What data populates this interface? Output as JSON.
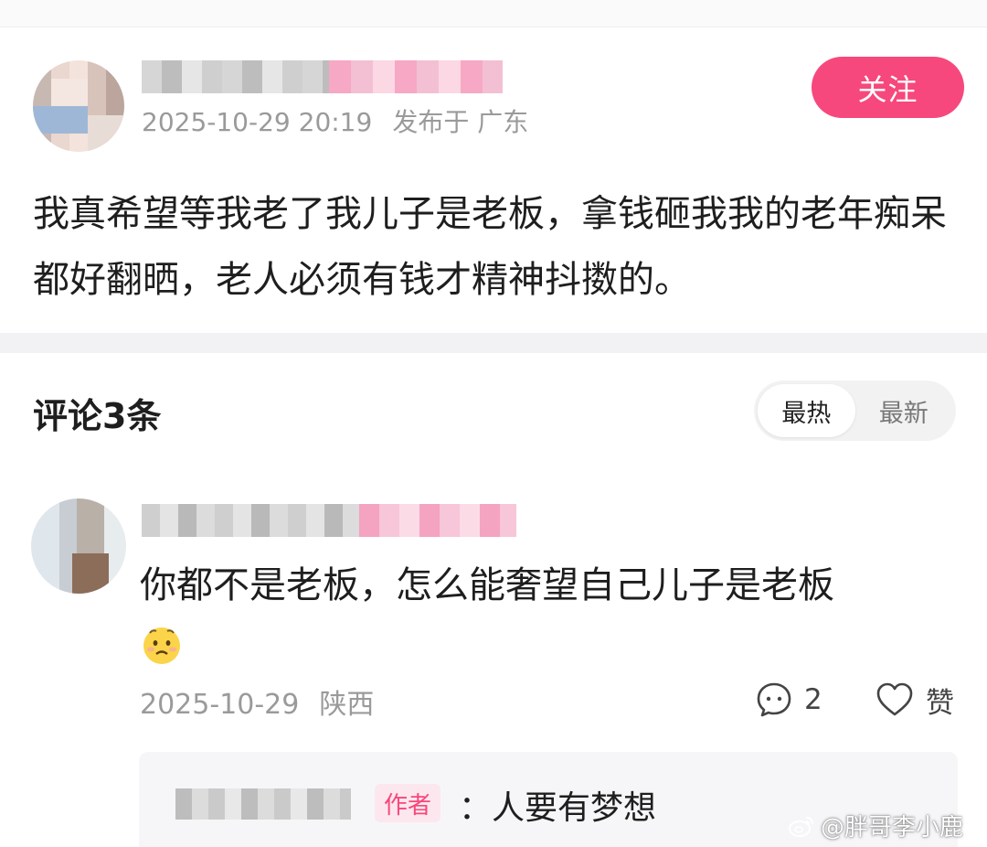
{
  "post": {
    "timestamp": "2025-10-29 20:19",
    "location": "发布于 广东",
    "follow_label": "关注",
    "body": "我真希望等我老了我儿子是老板，拿钱砸我我的老年痴呆都好翻晒，老人必须有钱才精神抖擞的。"
  },
  "comments_section": {
    "title": "评论3条",
    "sort_options": [
      "最热",
      "最新"
    ],
    "active_sort": "最热"
  },
  "comment": {
    "text": "你都不是老板，怎么能奢望自己儿子是老板",
    "emoji": "worried-face",
    "date": "2025-10-29",
    "location": "陕西",
    "reply_count": "2",
    "like_label": "赞"
  },
  "reply": {
    "author_tag": "作者",
    "text": "：人要有梦想"
  },
  "watermark": "@胖哥李小鹿",
  "colors": {
    "accent": "#f6487c",
    "meta_text": "#9a9a9a",
    "reply_bg": "#f6f6f8"
  }
}
